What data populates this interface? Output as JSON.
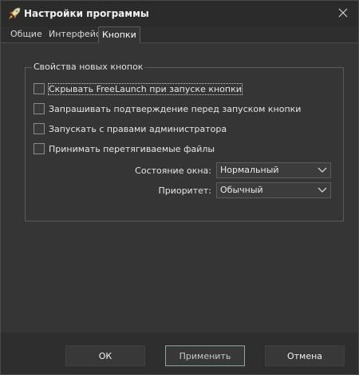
{
  "window": {
    "title": "Настройки программы",
    "close_glyph": "✕"
  },
  "tabs": [
    {
      "label": "Общие",
      "active": false
    },
    {
      "label": "Интерфейс",
      "active": false
    },
    {
      "label": "Кнопки",
      "active": true
    }
  ],
  "group": {
    "caption": "Свойства новых кнопок",
    "checkboxes": [
      {
        "label": "Скрывать FreeLaunch при запуске кнопки",
        "checked": false,
        "focused": true
      },
      {
        "label": "Запрашивать подтверждение перед запуском кнопки",
        "checked": false,
        "focused": false
      },
      {
        "label": "Запускать с правами администратора",
        "checked": false,
        "focused": false
      },
      {
        "label": "Принимать перетягиваемые файлы",
        "checked": false,
        "focused": false
      }
    ],
    "window_state": {
      "label": "Состояние окна:",
      "value": "Нормальный"
    },
    "priority": {
      "label": "Приоритет:",
      "value": "Обычный"
    }
  },
  "buttons": {
    "ok": "ОК",
    "apply": "Применить",
    "cancel": "Отмена"
  },
  "icons": {
    "app": "rocket-icon",
    "close": "close-icon",
    "combo_arrow": "chevron-down-icon"
  }
}
